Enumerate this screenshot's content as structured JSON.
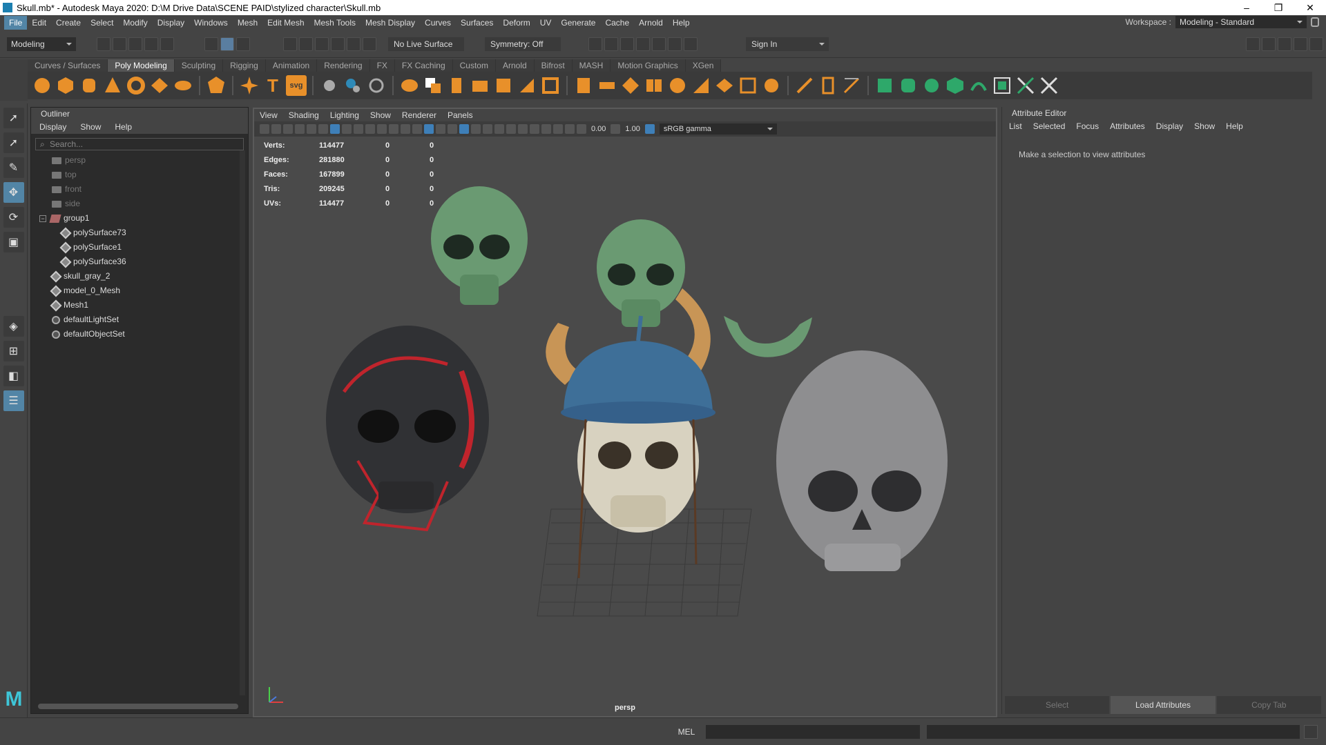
{
  "titlebar": {
    "title": "Skull.mb* - Autodesk Maya 2020: D:\\M Drive Data\\SCENE PAID\\stylized character\\Skull.mb",
    "minimize": "–",
    "maximize": "❐",
    "close": "✕"
  },
  "menubar": {
    "items": [
      "File",
      "Edit",
      "Create",
      "Select",
      "Modify",
      "Display",
      "Windows",
      "Mesh",
      "Edit Mesh",
      "Mesh Tools",
      "Mesh Display",
      "Curves",
      "Surfaces",
      "Deform",
      "UV",
      "Generate",
      "Cache",
      "Arnold",
      "Help"
    ],
    "workspace_label": "Workspace :",
    "workspace_value": "Modeling - Standard"
  },
  "statusline": {
    "mode": "Modeling",
    "live_surface": "No Live Surface",
    "symmetry": "Symmetry: Off",
    "sign_in": "Sign In"
  },
  "shelf": {
    "tabs": [
      "Curves / Surfaces",
      "Poly Modeling",
      "Sculpting",
      "Rigging",
      "Animation",
      "Rendering",
      "FX",
      "FX Caching",
      "Custom",
      "Arnold",
      "Bifrost",
      "MASH",
      "Motion Graphics",
      "XGen"
    ],
    "active_tab": "Poly Modeling",
    "text_tool": "T",
    "svg_tool": "svg"
  },
  "outliner": {
    "title": "Outliner",
    "menu": [
      "Display",
      "Show",
      "Help"
    ],
    "search_placeholder": "Search...",
    "items": [
      {
        "label": "persp",
        "type": "camera",
        "indent": 0
      },
      {
        "label": "top",
        "type": "camera",
        "indent": 0
      },
      {
        "label": "front",
        "type": "camera",
        "indent": 0
      },
      {
        "label": "side",
        "type": "camera",
        "indent": 0
      },
      {
        "label": "group1",
        "type": "group",
        "indent": 0,
        "expanded": true
      },
      {
        "label": "polySurface73",
        "type": "mesh",
        "indent": 1
      },
      {
        "label": "polySurface1",
        "type": "mesh",
        "indent": 1
      },
      {
        "label": "polySurface36",
        "type": "mesh",
        "indent": 1
      },
      {
        "label": "skull_gray_2",
        "type": "mesh",
        "indent": 0
      },
      {
        "label": "model_0_Mesh",
        "type": "mesh",
        "indent": 0
      },
      {
        "label": "Mesh1",
        "type": "mesh",
        "indent": 0
      },
      {
        "label": "defaultLightSet",
        "type": "set",
        "indent": 0
      },
      {
        "label": "defaultObjectSet",
        "type": "set",
        "indent": 0
      }
    ]
  },
  "viewport": {
    "menu": [
      "View",
      "Shading",
      "Lighting",
      "Show",
      "Renderer",
      "Panels"
    ],
    "exposure": "0.00",
    "gamma": "1.00",
    "color_space": "sRGB gamma",
    "hud": [
      {
        "label": "Verts:",
        "value": "114477",
        "sel": "0",
        "comp": "0"
      },
      {
        "label": "Edges:",
        "value": "281880",
        "sel": "0",
        "comp": "0"
      },
      {
        "label": "Faces:",
        "value": "167899",
        "sel": "0",
        "comp": "0"
      },
      {
        "label": "Tris:",
        "value": "209245",
        "sel": "0",
        "comp": "0"
      },
      {
        "label": "UVs:",
        "value": "114477",
        "sel": "0",
        "comp": "0"
      }
    ],
    "camera": "persp"
  },
  "attribute_editor": {
    "title": "Attribute Editor",
    "menu": [
      "List",
      "Selected",
      "Focus",
      "Attributes",
      "Display",
      "Show",
      "Help"
    ],
    "message": "Make a selection to view attributes",
    "buttons": [
      "Select",
      "Load Attributes",
      "Copy Tab"
    ]
  },
  "cmdline": {
    "lang": "MEL"
  },
  "colors": {
    "accent": "#5285a6",
    "shelf_icon": "#e8902a",
    "shelf_icon_green": "#2ea86a",
    "logo": "#3ec6d8"
  }
}
